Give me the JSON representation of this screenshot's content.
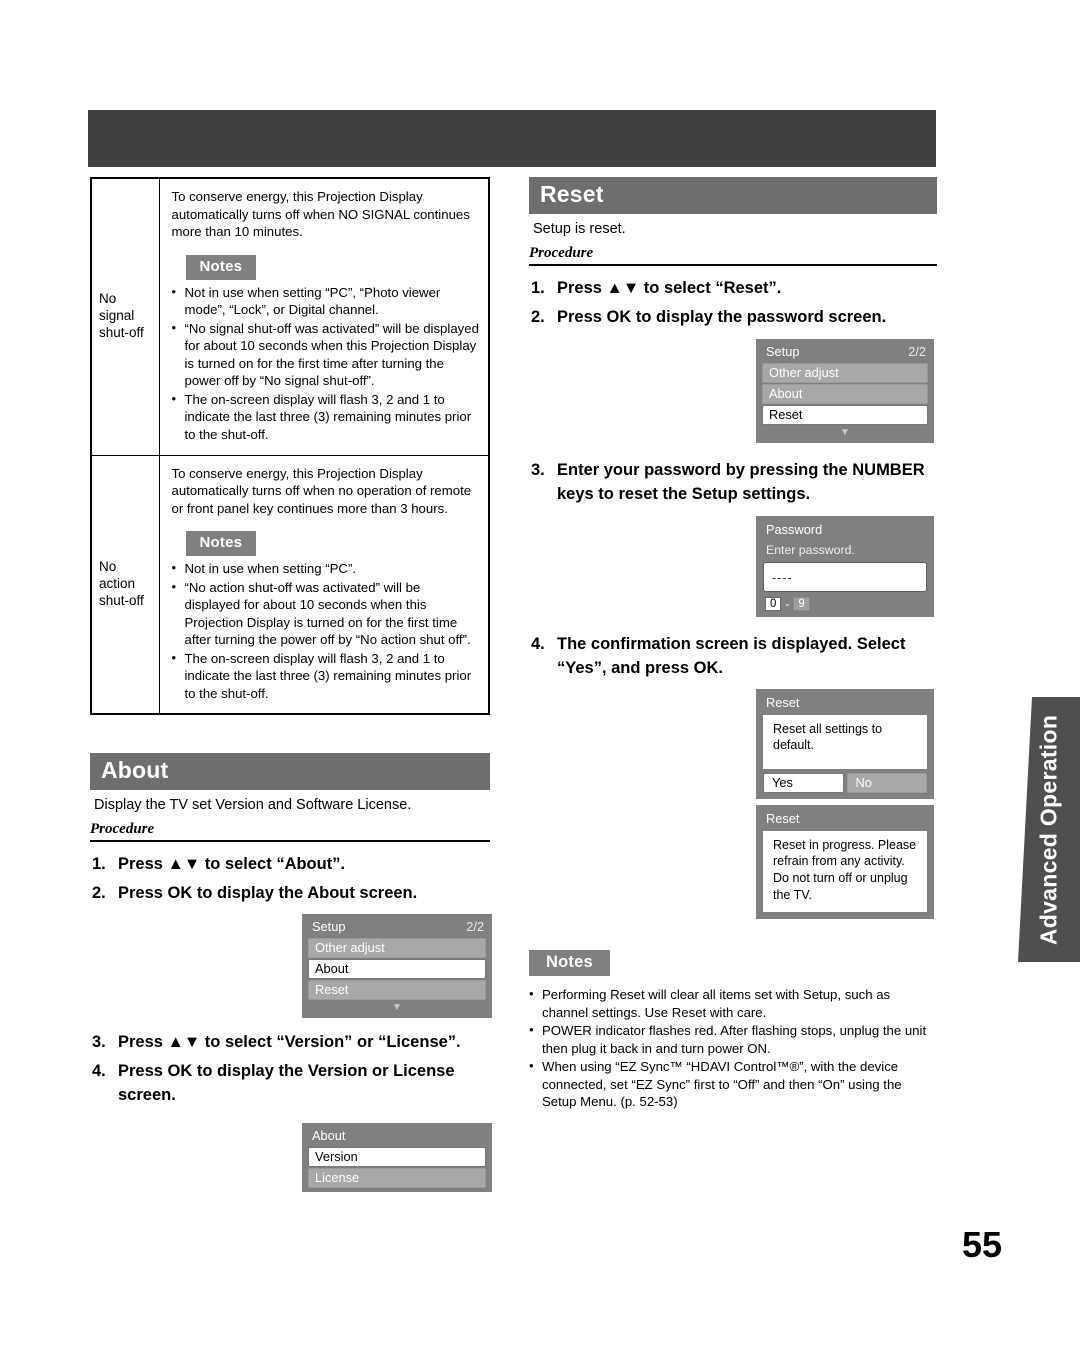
{
  "page": {
    "number": "55",
    "side_tab": "Advanced Operation"
  },
  "table": {
    "rows": [
      {
        "label": "No signal\nshut-off",
        "intro": "To conserve energy, this Projection Display automatically turns off when NO SIGNAL continues more than 10 minutes.",
        "notes_label": "Notes",
        "notes": [
          "Not in use when setting “PC”, “Photo viewer mode”, “Lock”, or Digital channel.",
          "“No signal shut-off was activated” will be displayed for about 10 seconds when this Projection Display is turned on for the first time after turning the power off by “No signal shut-off”.",
          "The on-screen display will flash 3, 2 and 1 to indicate the last three (3) remaining minutes prior to the shut-off."
        ]
      },
      {
        "label": "No action\nshut-off",
        "intro": "To conserve energy, this Projection Display automatically turns off when no operation of remote or front panel key continues more than 3 hours.",
        "notes_label": "Notes",
        "notes": [
          "Not in use when setting “PC”.",
          "“No action shut-off was activated” will be displayed for about 10 seconds when this Projection Display is turned on for the first time after turning the power off by “No action shut off”.",
          "The on-screen display will flash 3, 2 and 1 to indicate the last three (3) remaining minutes prior to the shut-off."
        ]
      }
    ]
  },
  "about": {
    "title": "About",
    "description": "Display the TV set Version and Software License.",
    "procedure_label": "Procedure",
    "steps": [
      {
        "num": "1.",
        "text": "Press ▲▼ to select “About”."
      },
      {
        "num": "2.",
        "text": "Press OK to display the About screen."
      },
      {
        "num": "3.",
        "text": "Press ▲▼ to select “Version” or “License”."
      },
      {
        "num": "4.",
        "text": "Press OK to display the Version or License screen."
      }
    ],
    "setup_screen": {
      "title": "Setup",
      "page_indicator": "2/2",
      "items": [
        {
          "label": "Other adjust",
          "selected": false
        },
        {
          "label": "About",
          "selected": true
        },
        {
          "label": "Reset",
          "selected": false
        }
      ],
      "scroll_arrow": "▼"
    },
    "about_screen": {
      "title": "About",
      "items": [
        {
          "label": "Version",
          "selected": true
        },
        {
          "label": "License",
          "selected": false
        }
      ]
    }
  },
  "reset": {
    "title": "Reset",
    "description": "Setup is reset.",
    "procedure_label": "Procedure",
    "steps": [
      {
        "num": "1.",
        "text": "Press ▲▼ to select “Reset”."
      },
      {
        "num": "2.",
        "text": "Press OK to display the password screen."
      },
      {
        "num": "3.",
        "text": "Enter your password by pressing the NUMBER keys to reset the Setup settings."
      },
      {
        "num": "4.",
        "text": "The confirmation screen is displayed. Select “Yes”, and press OK."
      }
    ],
    "setup_screen": {
      "title": "Setup",
      "page_indicator": "2/2",
      "items": [
        {
          "label": "Other adjust",
          "selected": false
        },
        {
          "label": "About",
          "selected": false
        },
        {
          "label": "Reset",
          "selected": true
        }
      ],
      "scroll_arrow": "▼"
    },
    "password_screen": {
      "title": "Password",
      "prompt": "Enter password.",
      "field_value": "----",
      "range_from": "0",
      "range_sep": "-",
      "range_to": "9"
    },
    "confirm_screen": {
      "title": "Reset",
      "message": "Reset all settings to default.",
      "yes_label": "Yes",
      "no_label": "No"
    },
    "progress_screen": {
      "title": "Reset",
      "message": "Reset in progress. Please refrain from any activity. Do not turn off or unplug the TV."
    },
    "notes_label": "Notes",
    "notes": [
      "Performing Reset will clear all items set with Setup, such as channel settings. Use Reset with care.",
      "POWER indicator flashes red. After flashing stops, unplug the unit then plug it back in and turn power ON.",
      "When using “EZ Sync™ “HDAVI Control™®”, with the device connected, set “EZ Sync” first to “Off” and then “On” using the Setup Menu. (p. 52-53)"
    ]
  },
  "colors": {
    "header_band": "#414141",
    "section_bar": "#6e6e6e",
    "notes_badge": "#808080",
    "osd_bg": "#808080",
    "side_tab": "#4f4f4f"
  }
}
